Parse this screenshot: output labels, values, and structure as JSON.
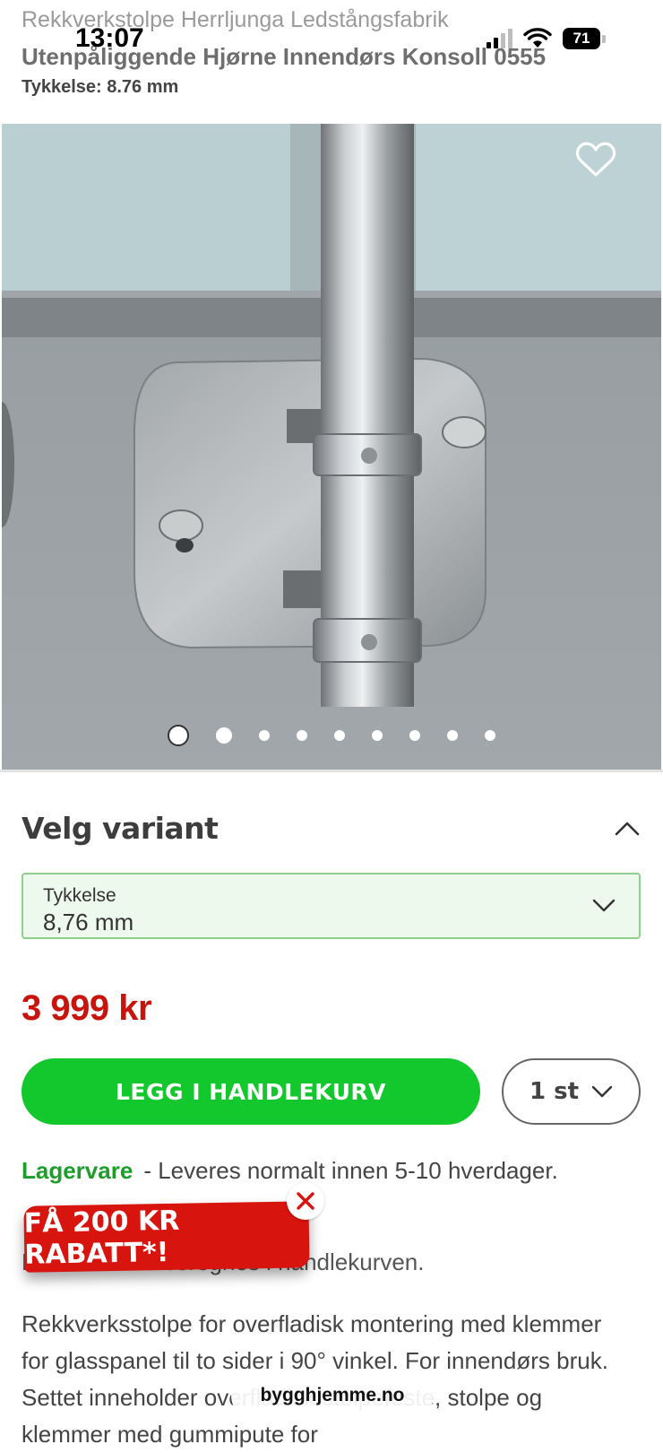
{
  "status_bar": {
    "time": "13:07",
    "battery": "71"
  },
  "header": {
    "brand": "Rekkverkstolpe Herrljunga Ledstångsfabrik",
    "title": "Utenpåliggende Hjørne Innendørs Konsoll 0555",
    "thickness": "Tykkelse: 8.76 mm"
  },
  "gallery": {
    "image_count": 9,
    "active_index": 0
  },
  "variant": {
    "heading": "Velg variant",
    "select_label": "Tykkelse",
    "select_value": "8,76 mm"
  },
  "price": "3 999 kr",
  "cart": {
    "button_label": "LEGG I HANDLEKURV",
    "quantity": "1 st"
  },
  "stock": {
    "status": "Lagervare",
    "delivery": "- Leveres normalt innen 5-10 hverdager."
  },
  "shipping_text": "Fraktkostnad beregnes i handlekurven.",
  "discount_banner": "FÅ 200 KR RABATT*!",
  "description": "Rekkverksstolpe for overfladisk montering med klemmer for glasspanel til to sider i 90° vinkel. For innendørs bruk. Settet inneholder overfladisk stolpefeste, stolpe og klemmer med gummipute for",
  "browser": {
    "url": "bygghjemme.no"
  },
  "colors": {
    "accent_green": "#12c82c",
    "price_red": "#c8140c",
    "stock_green": "#1f9d2b",
    "banner_red": "#d7140e"
  }
}
